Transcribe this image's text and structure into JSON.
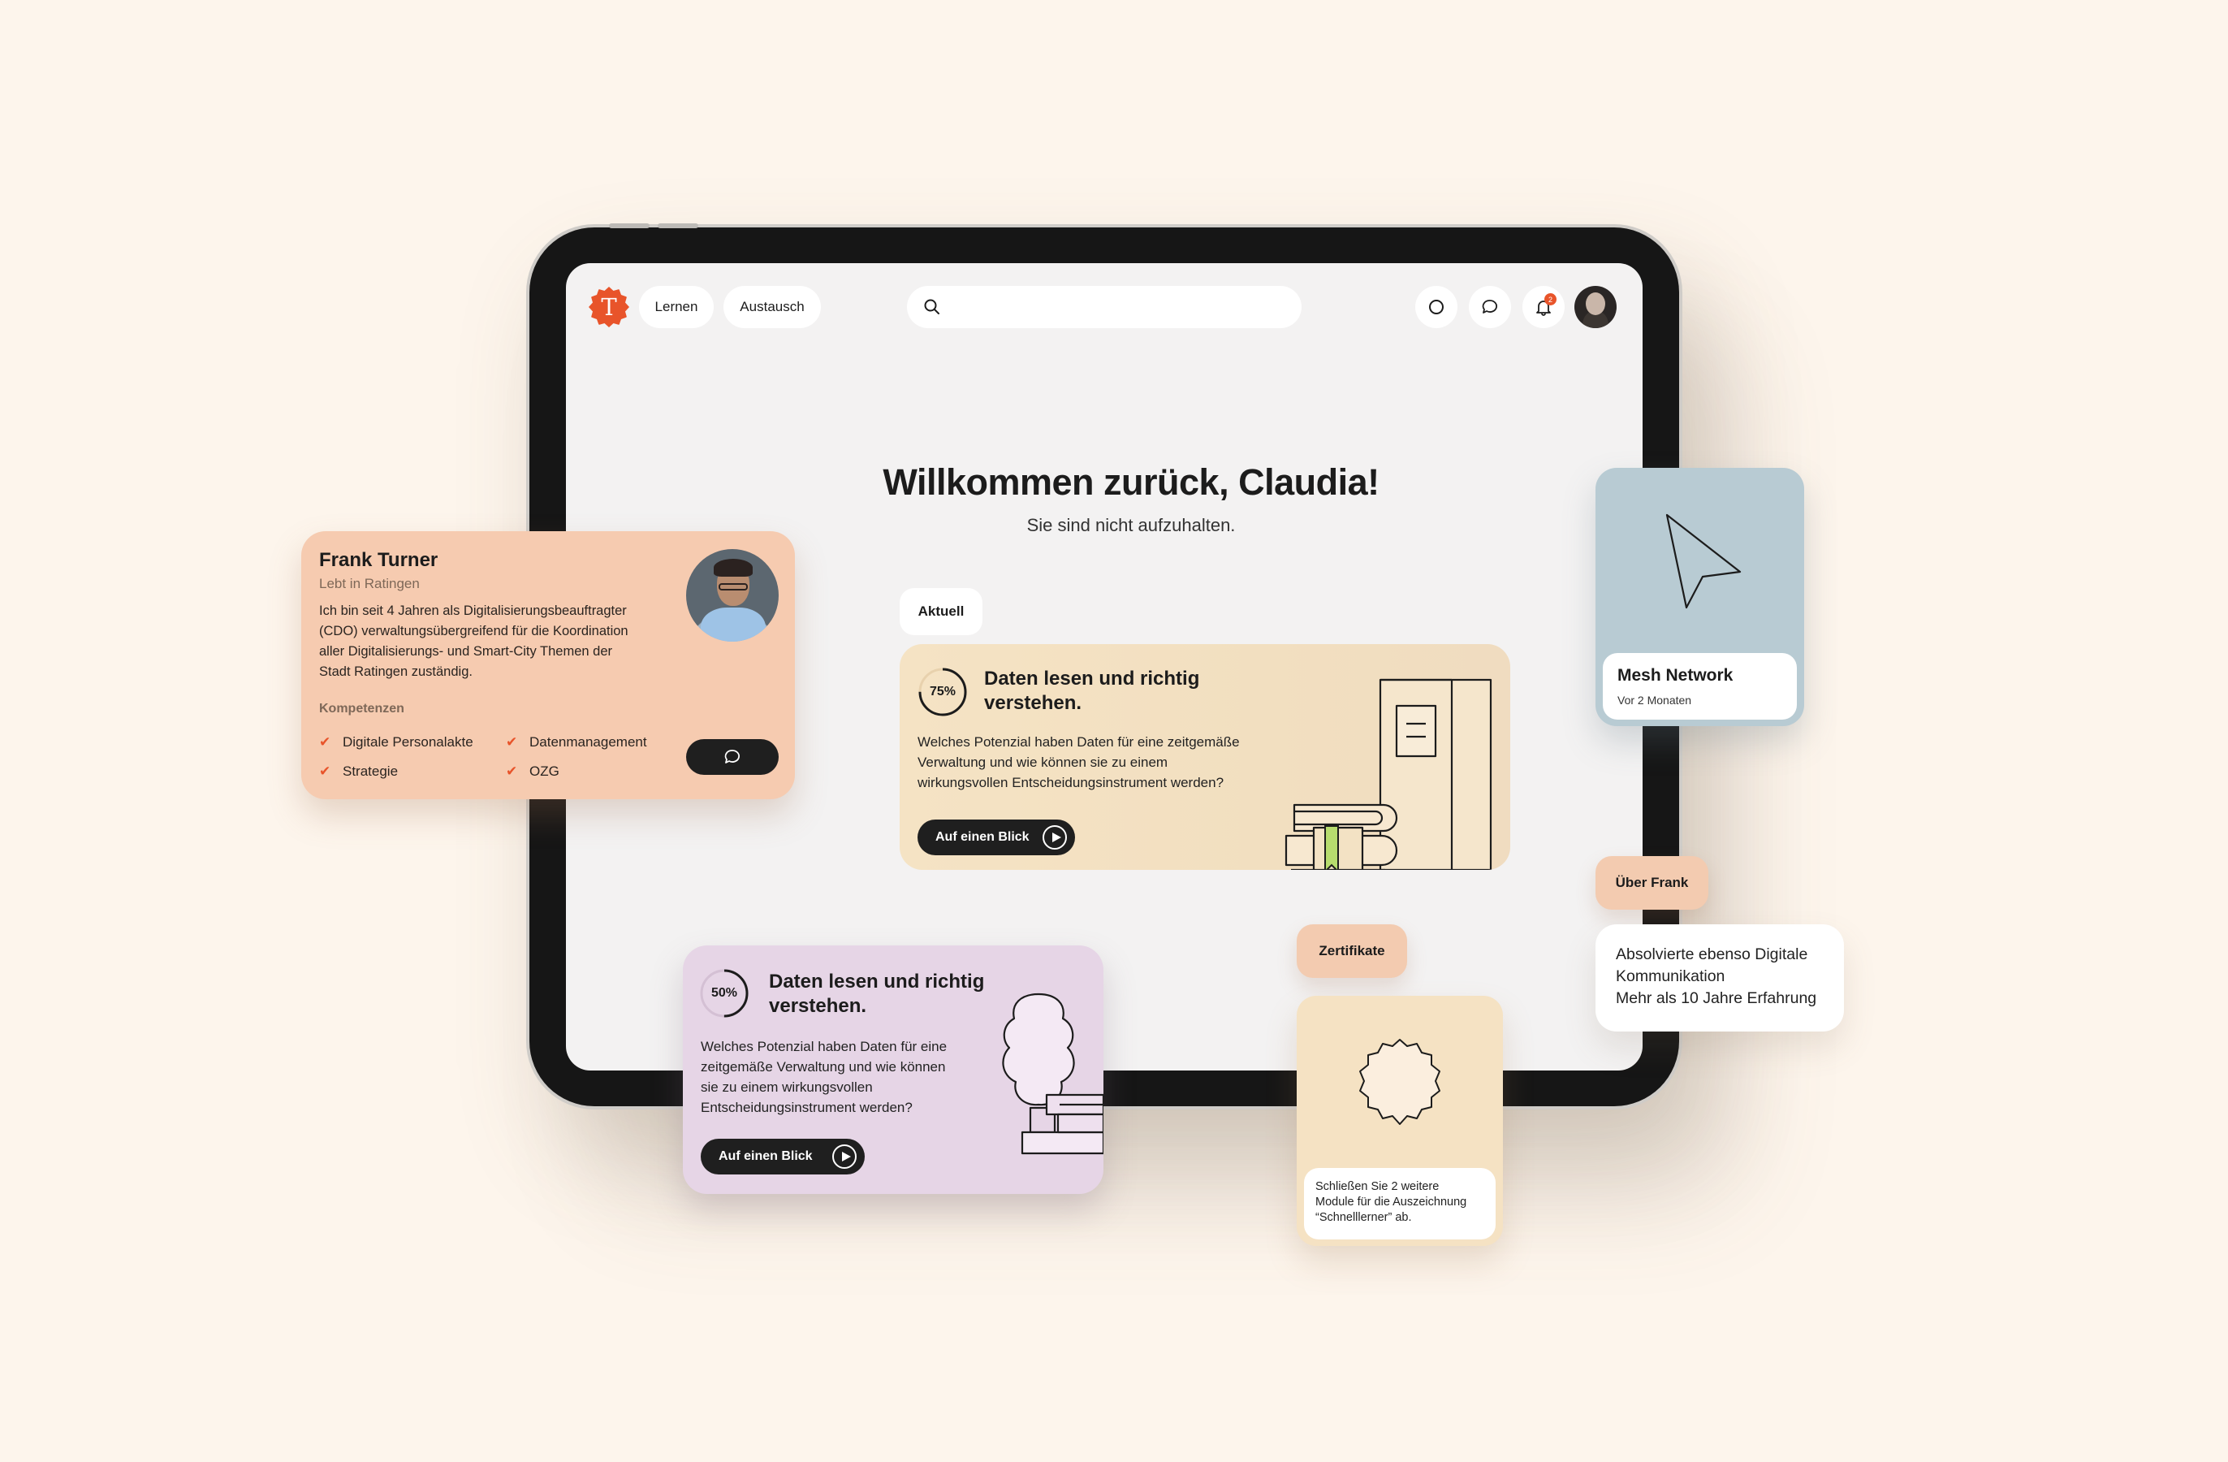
{
  "nav": {
    "logo_letter": "T",
    "lernen": "Lernen",
    "austausch": "Austausch",
    "notification_count": "2"
  },
  "welcome": {
    "title": "Willkommen zurück, Claudia!",
    "subtitle": "Sie sind nicht aufzuhalten."
  },
  "current": {
    "tag": "Aktuell",
    "progress_label": "75%",
    "progress": 0.75,
    "title_line1": "Daten lesen und richtig",
    "title_line2": "verstehen.",
    "desc_line1": "Welches Potenzial haben Daten für eine zeitgemäße",
    "desc_line2": "Verwaltung und wie können sie zu einem",
    "desc_line3": "wirkungsvollen Entscheidungsinstrument werden?",
    "button": "Auf einen Blick"
  },
  "profile": {
    "name": "Frank Turner",
    "location": "Lebt in Ratingen",
    "bio_line1": "Ich bin seit 4 Jahren als Digitalisierungsbeauftragter",
    "bio_line2": "(CDO) verwaltungsübergreifend für die Koordination",
    "bio_line3": "aller Digitalisierungs- und Smart-City Themen der",
    "bio_line4": "Stadt Ratingen zuständig.",
    "skills_heading": "Kompetenzen",
    "skills": [
      "Digitale Personalakte",
      "Datenmanagement",
      "Strategie",
      "OZG"
    ]
  },
  "course2": {
    "progress_label": "50%",
    "progress": 0.5,
    "title_line1": "Daten lesen und richtig",
    "title_line2": "verstehen.",
    "desc_line1": "Welches Potenzial haben Daten für eine",
    "desc_line2": "zeitgemäße Verwaltung und wie können",
    "desc_line3": "sie zu einem wirkungsvollen",
    "desc_line4": "Entscheidungsinstrument werden?",
    "button": "Auf einen Blick"
  },
  "mesh": {
    "title": "Mesh Network",
    "time": "Vor 2 Monaten"
  },
  "ueber": {
    "tag": "Über Frank",
    "line1": "Absolvierte ebenso Digitale",
    "line2": "Kommunikation",
    "line3": "Mehr als 10 Jahre Erfahrung"
  },
  "zertifikate": {
    "tag": "Zertifikate",
    "line1": "Schließen Sie 2 weitere",
    "line2": "Module für die Auszeichnung",
    "line3": "“Schnelllerner” ab."
  },
  "colors": {
    "accent": "#e8542a",
    "background": "#fdf5ec",
    "course_card": "#f2dfc0",
    "profile_card": "#f6cbb0",
    "lilac_card": "#e6d5e6",
    "mesh_card": "#b8cbd3"
  }
}
